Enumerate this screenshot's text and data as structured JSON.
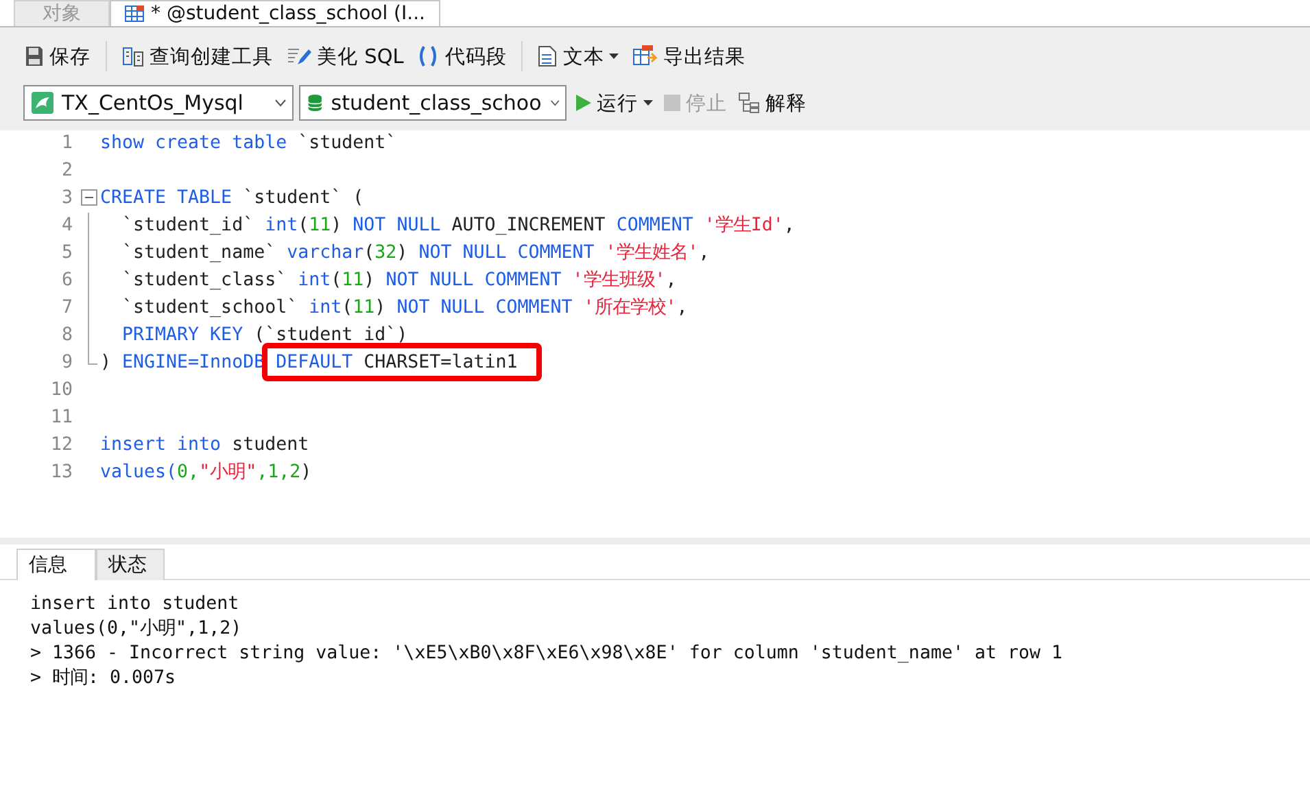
{
  "editor_tabs": [
    {
      "label": "对象",
      "selected": false
    },
    {
      "label": "@student_class_school (I...",
      "modified": "*",
      "selected": true
    }
  ],
  "toolbar": [
    {
      "kind": "save",
      "label": "保存"
    },
    {
      "kind": "builder",
      "label": "查询创建工具"
    },
    {
      "kind": "beautify",
      "label": "美化 SQL"
    },
    {
      "kind": "snippet",
      "label": "代码段"
    },
    {
      "kind": "text",
      "label": "文本",
      "dropdown": true
    },
    {
      "kind": "export",
      "label": "导出结果"
    }
  ],
  "connection": {
    "value": "TX_CentOs_Mysql"
  },
  "database": {
    "value": "student_class_schoo"
  },
  "actions": [
    {
      "kind": "run",
      "label": "运行",
      "dropdown": true,
      "disabled": false
    },
    {
      "kind": "stop",
      "label": "停止",
      "disabled": true
    },
    {
      "kind": "explain",
      "label": "解释",
      "disabled": false
    }
  ],
  "code_lines": [
    {
      "number": "1",
      "tokens": [
        {
          "kind": "kw",
          "text": "show create table"
        },
        {
          "kind": "plain",
          "text": " `student`"
        }
      ]
    },
    {
      "number": "2"
    },
    {
      "number": "3",
      "expanded": true,
      "tokens": [
        {
          "kind": "kw",
          "text": "CREATE TABLE"
        },
        {
          "kind": "plain",
          "text": " `student` ("
        }
      ],
      "children": [
        {
          "number": "4",
          "tokens": [
            {
              "kind": "plain",
              "text": "  `student_id` "
            },
            {
              "kind": "kw",
              "text": "int"
            },
            {
              "kind": "plain",
              "text": "("
            },
            {
              "kind": "num",
              "text": "11"
            },
            {
              "kind": "plain",
              "text": ") "
            },
            {
              "kind": "kw",
              "text": "NOT NULL"
            },
            {
              "kind": "plain",
              "text": " AUTO_INCREMENT "
            },
            {
              "kind": "kw",
              "text": "COMMENT "
            },
            {
              "kind": "str",
              "text": "'学生Id'"
            },
            {
              "kind": "plain",
              "text": ","
            }
          ]
        },
        {
          "number": "5",
          "tokens": [
            {
              "kind": "plain",
              "text": "  `student_name` "
            },
            {
              "kind": "kw",
              "text": "varchar"
            },
            {
              "kind": "plain",
              "text": "("
            },
            {
              "kind": "num",
              "text": "32"
            },
            {
              "kind": "plain",
              "text": ") "
            },
            {
              "kind": "kw",
              "text": "NOT NULL COMMENT "
            },
            {
              "kind": "str",
              "text": "'学生姓名'"
            },
            {
              "kind": "plain",
              "text": ","
            }
          ]
        },
        {
          "number": "6",
          "tokens": [
            {
              "kind": "plain",
              "text": "  `student_class` "
            },
            {
              "kind": "kw",
              "text": "int"
            },
            {
              "kind": "plain",
              "text": "("
            },
            {
              "kind": "num",
              "text": "11"
            },
            {
              "kind": "plain",
              "text": ") "
            },
            {
              "kind": "kw",
              "text": "NOT NULL COMMENT "
            },
            {
              "kind": "str",
              "text": "'学生班级'"
            },
            {
              "kind": "plain",
              "text": ","
            }
          ]
        },
        {
          "number": "7",
          "tokens": [
            {
              "kind": "plain",
              "text": "  `student_school` "
            },
            {
              "kind": "kw",
              "text": "int"
            },
            {
              "kind": "plain",
              "text": "("
            },
            {
              "kind": "num",
              "text": "11"
            },
            {
              "kind": "plain",
              "text": ") "
            },
            {
              "kind": "kw",
              "text": "NOT NULL COMMENT "
            },
            {
              "kind": "str",
              "text": "'所在学校'"
            },
            {
              "kind": "plain",
              "text": ","
            }
          ]
        },
        {
          "number": "8",
          "tokens": [
            {
              "kind": "kw",
              "text": "  PRIMARY KEY"
            },
            {
              "kind": "plain",
              "text": " (`student_id`)"
            }
          ]
        },
        {
          "number": "9",
          "tokens": [
            {
              "kind": "plain",
              "text": ") "
            },
            {
              "kind": "kw",
              "text": "ENGINE=InnoDB "
            },
            {
              "kind": "box",
              "tokens": [
                {
                  "kind": "kw",
                  "text": "DEFAULT"
                },
                {
                  "kind": "plain",
                  "text": " CHARSET=latin1"
                }
              ]
            }
          ]
        }
      ]
    },
    {
      "number": "10"
    },
    {
      "number": "11"
    },
    {
      "number": "12",
      "tokens": [
        {
          "kind": "kw",
          "text": "insert into"
        },
        {
          "kind": "plain",
          "text": " student"
        }
      ]
    },
    {
      "number": "13",
      "tokens": [
        {
          "kind": "kw",
          "text": "values("
        },
        {
          "kind": "num",
          "text": "0,"
        },
        {
          "kind": "str",
          "text": "\"小明\""
        },
        {
          "kind": "num",
          "text": ",1,2"
        },
        {
          "kind": "plain",
          "text": ")"
        }
      ]
    }
  ],
  "result_tabs": [
    {
      "label": "信息",
      "selected": true
    },
    {
      "label": "状态",
      "selected": false
    }
  ],
  "messages": [
    "insert into student",
    "values(0,\"小明\",1,2)",
    "> 1366 - Incorrect string value: '\\xE5\\xB0\\x8F\\xE6\\x98\\x8E' for column 'student_name' at row 1",
    "> 时间: 0.007s"
  ]
}
